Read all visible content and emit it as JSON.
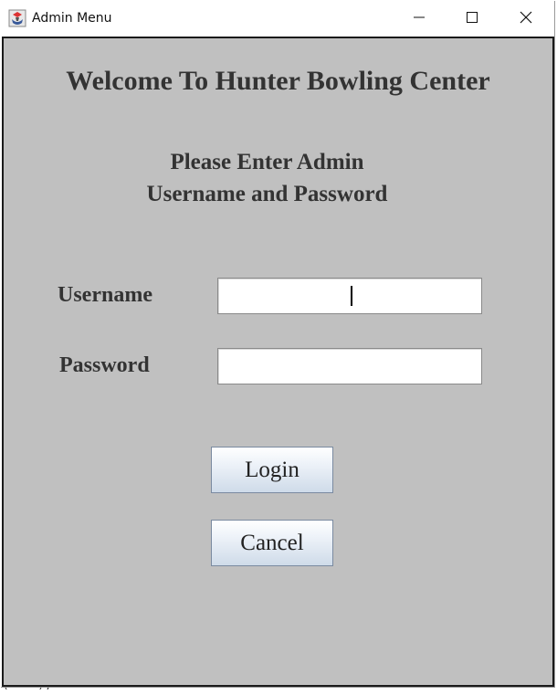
{
  "window": {
    "title": "Admin Menu",
    "app_icon": "java-cup-icon"
  },
  "controls": {
    "minimize_icon": "minimize-icon",
    "maximize_icon": "maximize-icon",
    "close_icon": "close-icon"
  },
  "form": {
    "heading": "Welcome To Hunter Bowling Center",
    "subheading_line1": "Please Enter Admin",
    "subheading_line2": "Username and Password",
    "username_label": "Username",
    "username_value": "",
    "password_label": "Password",
    "password_value": "",
    "login_label": "Login",
    "cancel_label": "Cancel"
  },
  "backdrop": {
    "code_fragment_start": "(",
    "code_fragment_keyword": "null",
    "code_fragment_end": ");"
  },
  "colors": {
    "panel_background": "#c0c0c0",
    "text": "#333333",
    "button_gradient_top": "#ffffff",
    "button_gradient_bottom": "#cfdbe9"
  }
}
